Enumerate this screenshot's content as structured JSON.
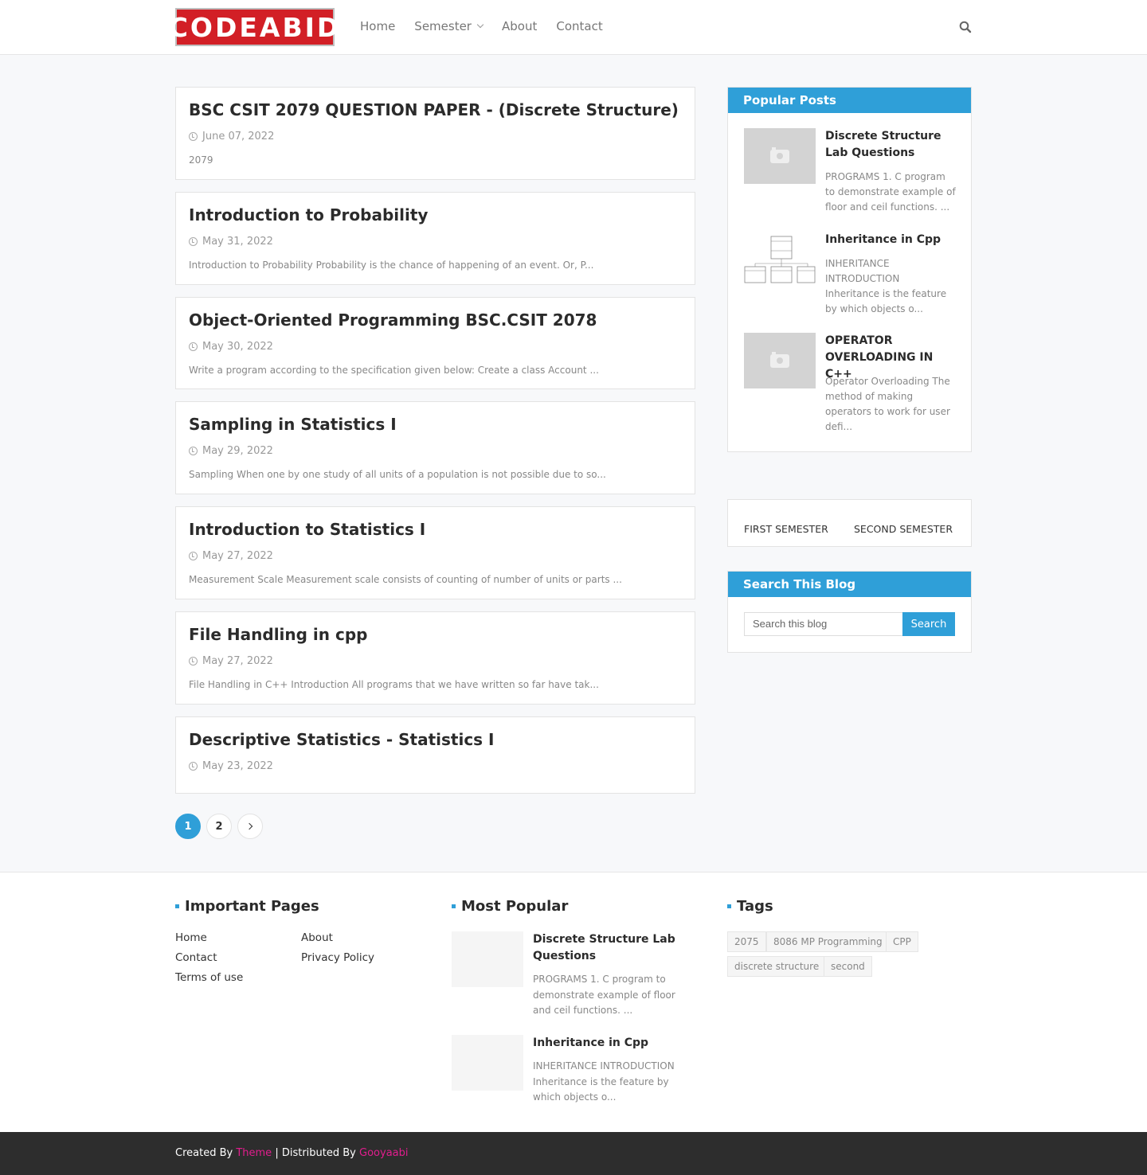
{
  "header": {
    "logo": "CODEABID",
    "nav": [
      {
        "label": "Home"
      },
      {
        "label": "Semester"
      },
      {
        "label": "About"
      },
      {
        "label": "Contact"
      }
    ]
  },
  "posts": [
    {
      "title": "BSC CSIT 2079 QUESTION PAPER - (Discrete Structure)",
      "date": "June 07, 2022",
      "snippet": "2079"
    },
    {
      "title": "Introduction to Probability",
      "date": "May 31, 2022",
      "snippet": "Introduction to Probability Probability is the chance of happening of an event. Or, P..."
    },
    {
      "title": "Object-Oriented Programming BSC.CSIT 2078",
      "date": "May 30, 2022",
      "snippet": "Write a program according to the specification given below:  Create a class Account ..."
    },
    {
      "title": "Sampling in Statistics I",
      "date": "May 29, 2022",
      "snippet": "Sampling When one by one study of all units of a population is not possible due to so..."
    },
    {
      "title": "Introduction to Statistics I",
      "date": "May 27, 2022",
      "snippet": "Measurement Scale Measurement scale consists of counting of number of units or parts ..."
    },
    {
      "title": "File Handling in cpp",
      "date": "May 27, 2022",
      "snippet": "File Handling in C++ Introduction All programs that we have written so far have tak..."
    },
    {
      "title": "Descriptive Statistics - Statistics I",
      "date": "May 23, 2022",
      "snippet": ""
    }
  ],
  "pagination": {
    "pages": [
      "1",
      "2"
    ],
    "current": "1"
  },
  "sidebar": {
    "popular_heading": "Popular Posts",
    "popular": [
      {
        "title": "Discrete Structure Lab Questions",
        "snippet": "PROGRAMS 1. C program to demonstrate example of floor and ceil functions. ..."
      },
      {
        "title": "Inheritance in Cpp",
        "snippet": "INHERITANCE  INTRODUCTION Inheritance is the feature by which objects o..."
      },
      {
        "title": "OPERATOR OVERLOADING IN C++",
        "snippet": "Operator Overloading The method of making operators to work for user defi..."
      }
    ],
    "semesters": [
      "FIRST SEMESTER",
      "SECOND SEMESTER"
    ],
    "search_heading": "Search This Blog",
    "search_placeholder": "Search this blog",
    "search_button": "Search"
  },
  "footer": {
    "important_heading": "Important Pages",
    "important_links": [
      "Home",
      "About",
      "Contact",
      "Privacy Policy",
      "Terms of use"
    ],
    "popular_heading": "Most Popular",
    "popular": [
      {
        "title": "Discrete Structure Lab Questions",
        "snippet": "PROGRAMS 1. C program to demonstrate example of floor and ceil functions. ..."
      },
      {
        "title": "Inheritance in Cpp",
        "snippet": "INHERITANCE  INTRODUCTION Inheritance is the feature by which objects o..."
      }
    ],
    "tags_heading": "Tags",
    "tags": [
      "2075",
      "8086 MP Programming",
      "CPP",
      "discrete structure",
      "second"
    ],
    "credits": {
      "created_by": "Created By",
      "theme": "Theme",
      "separator": "| Distributed By",
      "distributor": "Gooyaabi"
    }
  },
  "colors": {
    "accent": "#2f9fd8",
    "logo_bg": "#d21f26",
    "credit_link": "#e11d8d"
  }
}
